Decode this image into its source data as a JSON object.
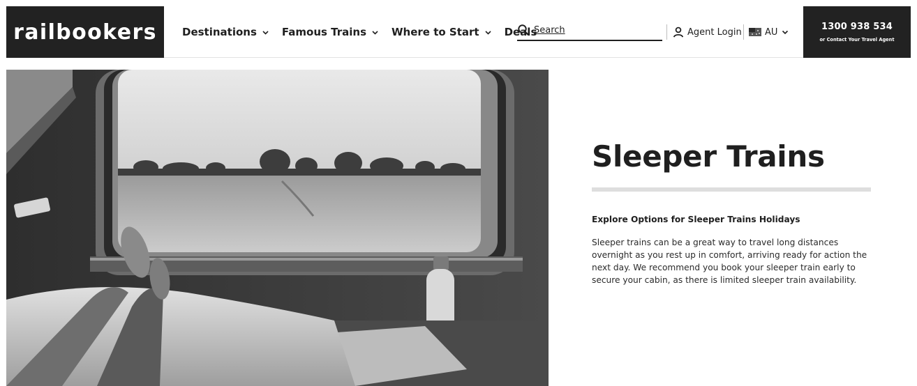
{
  "header": {
    "logo_text": "railbookers",
    "logo_mark": "·",
    "nav": [
      {
        "label": "Destinations",
        "has_dropdown": true
      },
      {
        "label": "Famous Trains",
        "has_dropdown": true
      },
      {
        "label": "Where to Start",
        "has_dropdown": true
      },
      {
        "label": "Deals",
        "has_dropdown": false
      }
    ],
    "search": {
      "placeholder": "Search",
      "icon": "search-icon"
    },
    "agent_login": {
      "label": "Agent Login",
      "icon": "user-icon"
    },
    "locale": {
      "label": "AU",
      "icon": "australia-flag-icon"
    },
    "contact": {
      "phone": "1300 938 534",
      "subtext": "or Contact Your Travel Agent"
    }
  },
  "hero": {
    "image_description": "Black and white photo from a sleeper train cabin: bare feet on a bed facing a window with an outback grassland and trees, a water bottle and a magazine on the table",
    "title": "Sleeper Trains",
    "subtitle": "Explore Options for Sleeper Trains Holidays",
    "body": "Sleeper   trains can be a great way to travel long distances overnight as you rest up in comfort, arriving ready for action the next day. We recommend you book your sleeper train early to secure your cabin, as there is limited sleeper train availability."
  },
  "colors": {
    "header_dark": "#222222",
    "text": "#1f1f1f",
    "divider": "#dedede"
  }
}
